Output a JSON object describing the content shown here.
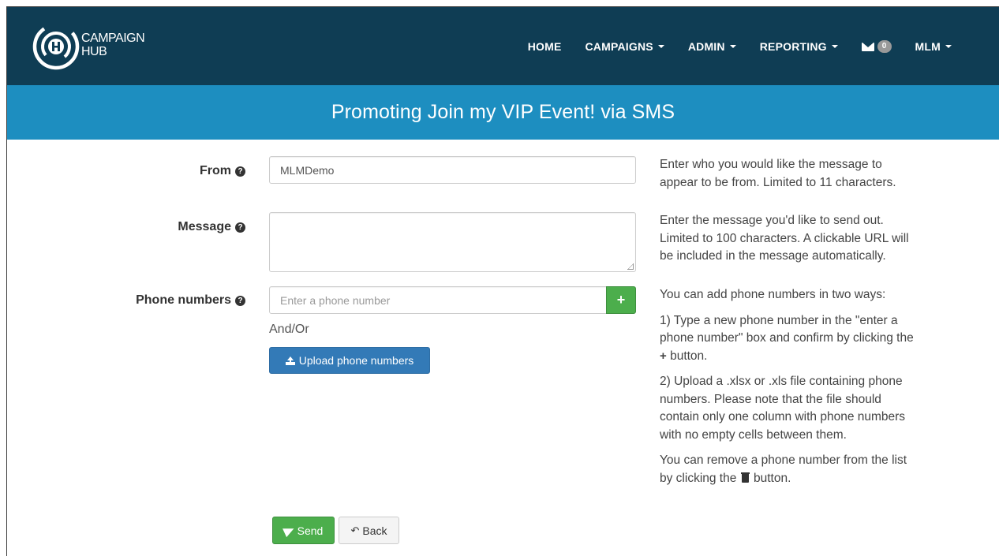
{
  "brand": {
    "line1": "CAMPAIGN",
    "line2": "HUB"
  },
  "nav": {
    "home": "HOME",
    "campaigns": "CAMPAIGNS",
    "admin": "ADMIN",
    "reporting": "REPORTING",
    "messages_count": "0",
    "user": "MLM"
  },
  "banner": {
    "title": "Promoting Join my VIP Event! via SMS"
  },
  "form": {
    "from_label": "From",
    "from_value": "MLMDemo",
    "message_label": "Message",
    "message_value": "",
    "phone_label": "Phone numbers",
    "phone_placeholder": "Enter a phone number",
    "add_button": "+",
    "andor": "And/Or",
    "upload_label": "Upload phone numbers",
    "send_label": "Send",
    "back_label": "Back"
  },
  "help": {
    "from_1": "Enter who you would like the message to",
    "from_2": "appear to be from. Limited to 11 characters.",
    "message_1": "Enter the message you'd like to send out.",
    "message_2": "Limited to 100 characters. A clickable URL will",
    "message_3": "be included in the message automatically.",
    "phone_intro": "You can add phone numbers in two ways:",
    "way1_1": "1) Type a new phone number in the \"enter a",
    "way1_2": "phone number\" box and confirm by clicking the",
    "way1_3": "button.",
    "way2_1": "2) Upload a .xlsx or .xls file containing phone",
    "way2_2": "numbers. Please note that the file should",
    "way2_3": "contain only one column with phone numbers",
    "way2_4": "with no empty cells between them.",
    "remove_1": "You can remove a phone number from the list",
    "remove_2a": "by clicking the",
    "remove_2b": "button."
  },
  "icons": {
    "question": "question-circle-icon",
    "mail": "envelope-icon",
    "upload": "upload-icon",
    "send": "paper-plane-icon",
    "back": "reply-arrow-icon",
    "trash": "trash-icon",
    "plus": "plus-icon"
  },
  "colors": {
    "navbar": "#0f3d54",
    "banner": "#1d8ec0",
    "success": "#4cae4c",
    "primary": "#337ab7"
  }
}
